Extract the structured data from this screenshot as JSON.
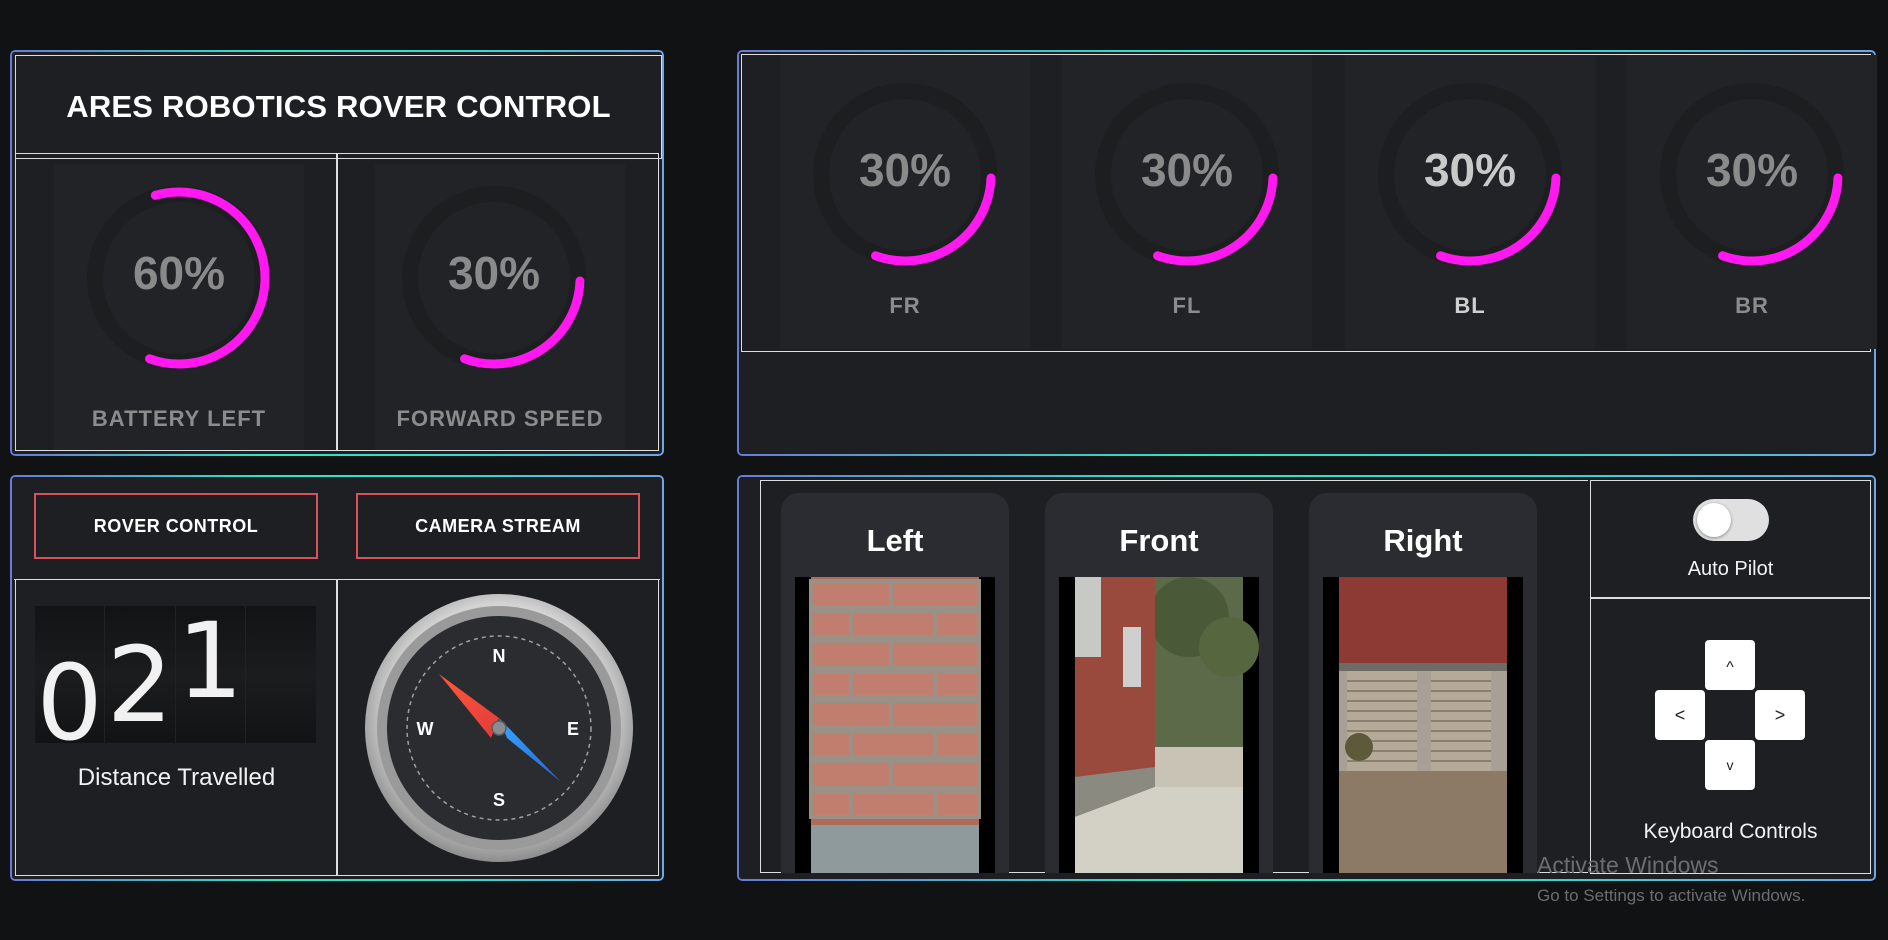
{
  "app": {
    "title": "ARES ROBOTICS ROVER CONTROL"
  },
  "stats": [
    {
      "value": "60%",
      "label": "BATTERY LEFT",
      "fraction": 0.6
    },
    {
      "value": "30%",
      "label": "FORWARD SPEED",
      "fraction": 0.3
    }
  ],
  "wheels": [
    {
      "value": "30%",
      "label": "FR",
      "fraction": 0.3
    },
    {
      "value": "30%",
      "label": "FL",
      "fraction": 0.3
    },
    {
      "value": "30%",
      "label": "BL",
      "fraction": 0.3
    },
    {
      "value": "30%",
      "label": "BR",
      "fraction": 0.3
    }
  ],
  "tabs": {
    "rover_control": "ROVER CONTROL",
    "camera_stream": "CAMERA STREAM"
  },
  "odometer": {
    "digits": [
      "0",
      "2",
      "1"
    ],
    "label": "Distance Travelled"
  },
  "compass": {
    "n": "N",
    "s": "S",
    "e": "E",
    "w": "W"
  },
  "cameras": [
    {
      "title": "Left"
    },
    {
      "title": "Front"
    },
    {
      "title": "Right"
    }
  ],
  "autopilot": {
    "label": "Auto Pilot",
    "enabled": false
  },
  "keyboard": {
    "label": "Keyboard Controls",
    "up": "^",
    "left": "<",
    "right": ">",
    "down": "v"
  },
  "watermark": {
    "line1": "Activate Windows",
    "line2": "Go to Settings to activate Windows."
  },
  "colors": {
    "accent": "#ff18f0",
    "button_border": "#d8505a",
    "panel": "#1e1f22",
    "background": "#111213"
  }
}
